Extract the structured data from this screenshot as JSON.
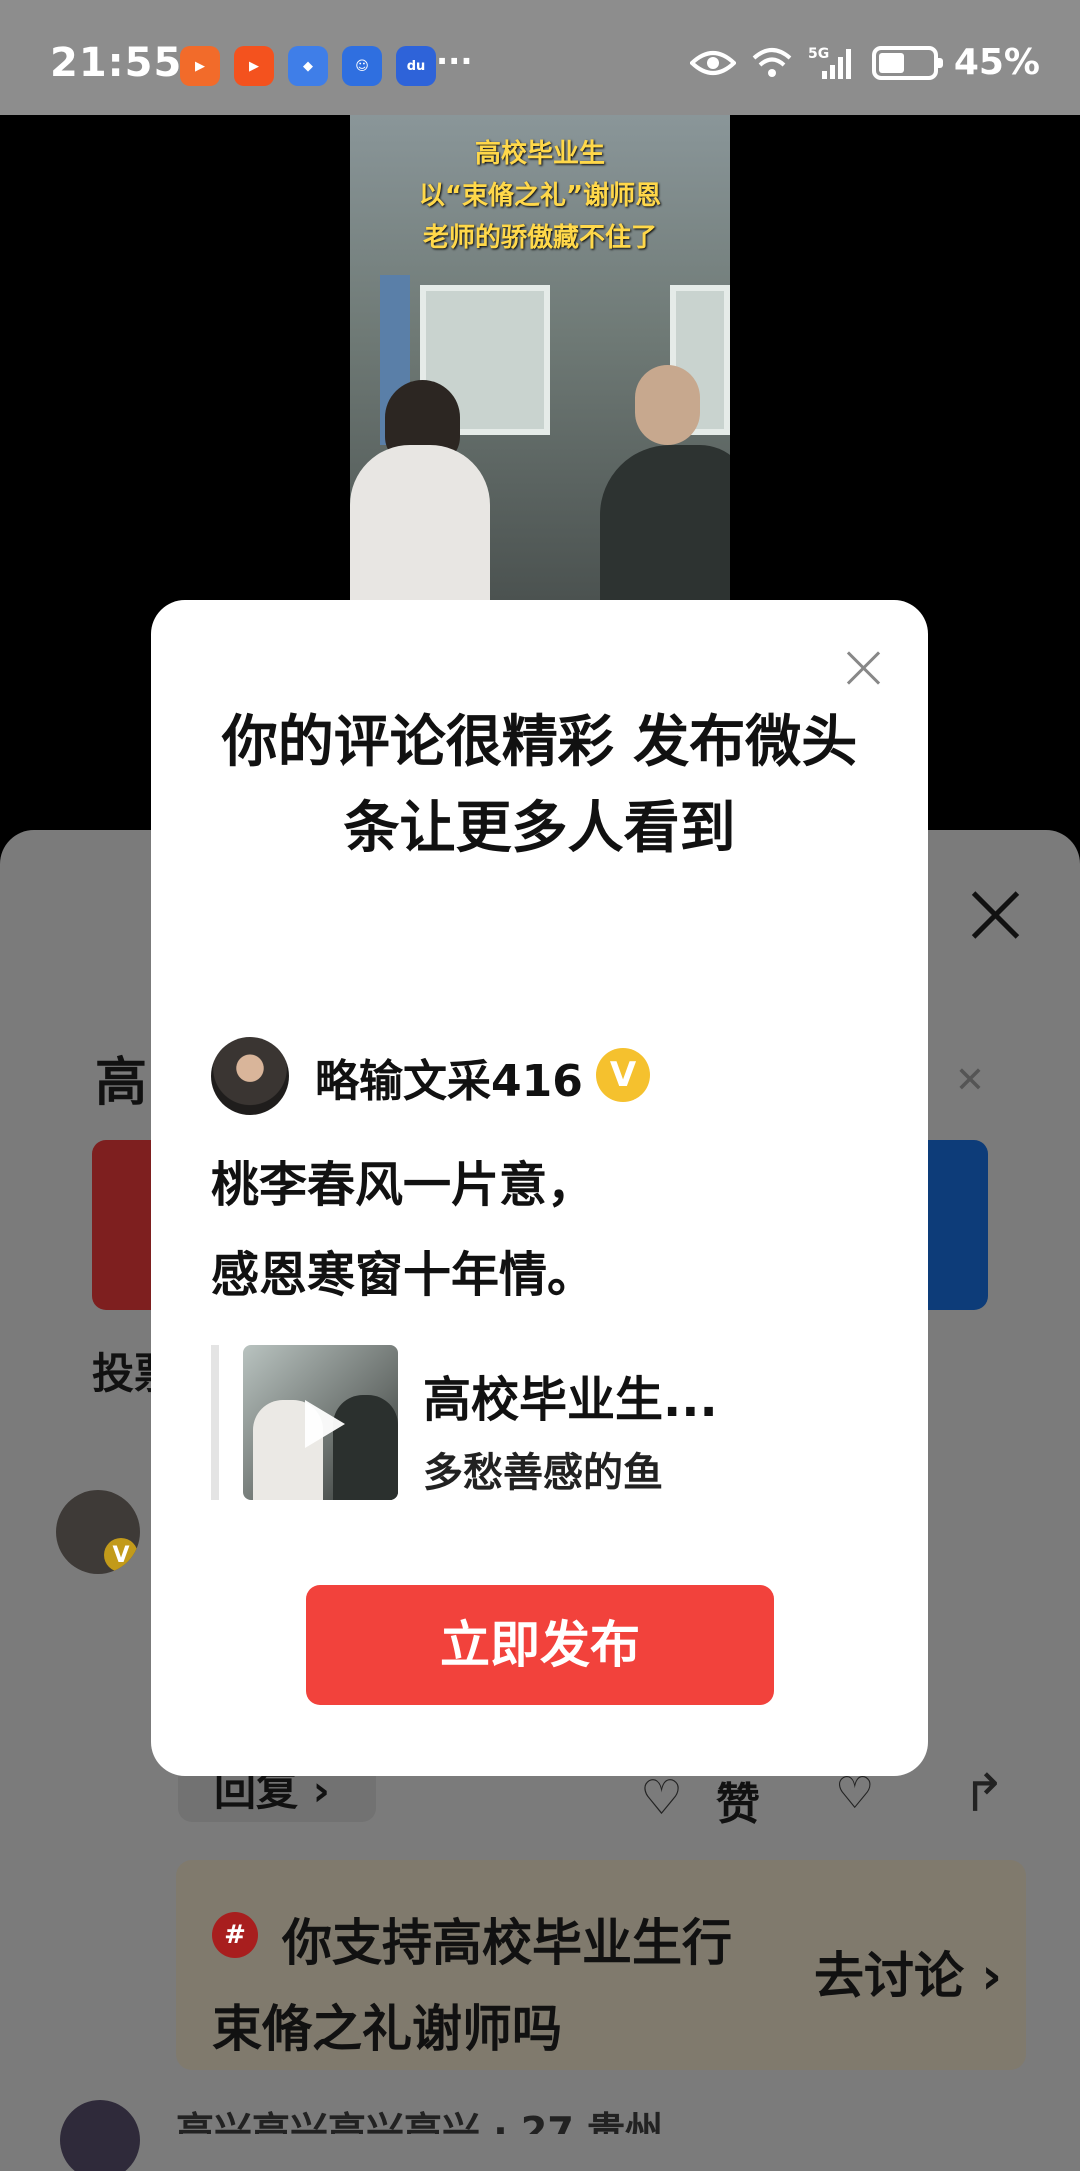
{
  "status_bar": {
    "time": "21:55",
    "battery_percent": "45%",
    "network": "5G",
    "app_icons": [
      "kuaishou-express-icon",
      "kuaishou-icon",
      "browser-icon",
      "assistant-icon",
      "baidu-icon"
    ]
  },
  "video": {
    "caption_lines": [
      "高校毕业生",
      "以“束脩之礼”谢师恩",
      "老师的骄傲藏不住了"
    ]
  },
  "background_sheet": {
    "title_partial": "高",
    "vote_label_partial": "投票",
    "reply_label": "回复 ›",
    "like_label": "赞",
    "topic_text": "你支持高校毕业生行束脩之礼谢师吗",
    "topic_action": "去讨论 ›",
    "bottom_user_partial": "高兴高兴高兴高兴 · 27 贵州"
  },
  "modal": {
    "title": "你的评论很精彩 发布微头条让更多人看到",
    "user_name": "略输文采416",
    "verified_badge": "V",
    "post_lines": [
      "桃李春风一片意，",
      "感恩寒窗十年情。"
    ],
    "quote_title": "高校毕业生...",
    "quote_author": "多愁善感的鱼",
    "publish_button": "立即发布"
  },
  "colors": {
    "publish_red": "#f2423c",
    "verified_gold": "#f5c12e",
    "video_caption": "#ffd84a"
  }
}
